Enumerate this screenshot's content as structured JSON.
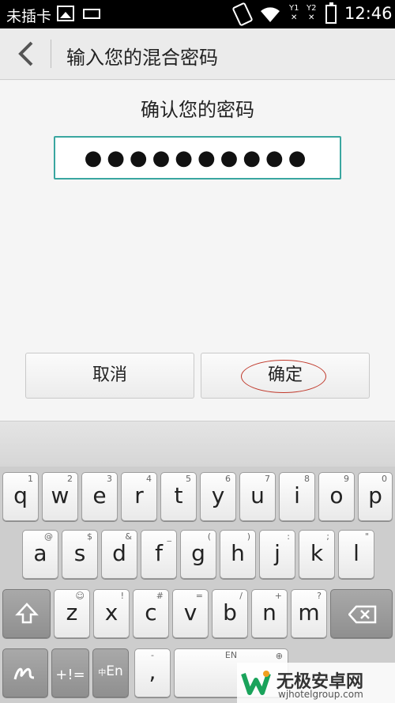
{
  "status_bar": {
    "carrier": "未插卡",
    "sim1": "1",
    "sim2": "2",
    "time": "12:46"
  },
  "title_bar": {
    "title": "输入您的混合密码",
    "back_icon": "chevron-left-icon"
  },
  "content": {
    "confirm_label": "确认您的密码",
    "password_value": "●●●●●●●●●●",
    "cancel_label": "取消",
    "ok_label": "确定"
  },
  "keyboard": {
    "row1": [
      {
        "key": "q",
        "hint": "1"
      },
      {
        "key": "w",
        "hint": "2"
      },
      {
        "key": "e",
        "hint": "3"
      },
      {
        "key": "r",
        "hint": "4"
      },
      {
        "key": "t",
        "hint": "5"
      },
      {
        "key": "y",
        "hint": "6"
      },
      {
        "key": "u",
        "hint": "7"
      },
      {
        "key": "i",
        "hint": "8"
      },
      {
        "key": "o",
        "hint": "9"
      },
      {
        "key": "p",
        "hint": "0"
      }
    ],
    "row2": [
      {
        "key": "a",
        "hint": "@"
      },
      {
        "key": "s",
        "hint": "$"
      },
      {
        "key": "d",
        "hint": "&"
      },
      {
        "key": "f",
        "hint": "_"
      },
      {
        "key": "g",
        "hint": "("
      },
      {
        "key": "h",
        "hint": ")"
      },
      {
        "key": "j",
        "hint": ":"
      },
      {
        "key": "k",
        "hint": ";"
      },
      {
        "key": "l",
        "hint": "\""
      }
    ],
    "row3": [
      {
        "key": "z",
        "hint": "☺"
      },
      {
        "key": "x",
        "hint": "!"
      },
      {
        "key": "c",
        "hint": "#"
      },
      {
        "key": "v",
        "hint": "="
      },
      {
        "key": "b",
        "hint": "/"
      },
      {
        "key": "n",
        "hint": "+"
      },
      {
        "key": "m",
        "hint": "?"
      }
    ],
    "symbols_label": "+!=",
    "lang_label": "En",
    "lang_prefix": "中",
    "comma_label": ",",
    "comma_hint": "-",
    "space_hint": "EN"
  },
  "watermark": {
    "title": "无极安卓网",
    "url": "wjhotelgroup.com"
  },
  "colors": {
    "accent": "#3aa6a0",
    "annotation": "#c0392b"
  }
}
